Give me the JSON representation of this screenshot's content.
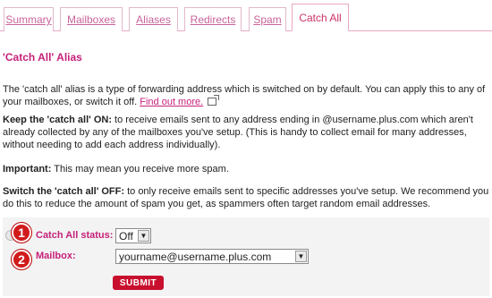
{
  "tabs": [
    {
      "label": "Summary"
    },
    {
      "label": "Mailboxes"
    },
    {
      "label": "Aliases"
    },
    {
      "label": "Redirects"
    },
    {
      "label": "Spam"
    },
    {
      "label": "Catch All",
      "active": true
    }
  ],
  "heading": "'Catch All' Alias",
  "intro": {
    "text": "The 'catch all' alias is a type of forwarding address which is switched on by default. You can apply this to any of your mailboxes, or switch it off.",
    "link": "Find out more."
  },
  "keep_on": {
    "bold": "Keep the 'catch all' ON:",
    "text": " to receive emails sent to any address ending in @username.plus.com which aren't already collected by any of the mailboxes you've setup. (This is handy to collect email for many addresses, without needing to add each address individually)."
  },
  "important": {
    "bold": "Important:",
    "text": " This may mean you receive more spam."
  },
  "switch_off": {
    "bold": "Switch the 'catch all' OFF:",
    "text": " to only receive emails sent to specific addresses you've setup. We recommend you do this to reduce the amount of spam you get, as spammers often target random email addresses."
  },
  "form": {
    "status_label": "Catch All status:",
    "status_value": "Off",
    "mailbox_label": "Mailbox:",
    "mailbox_value": "yourname@username.plus.com",
    "submit_label": "SUBMIT"
  },
  "badges": [
    "1",
    "2"
  ],
  "colors": {
    "accent": "#c6217a",
    "submit": "#c8102e",
    "badge": "#d11b1b"
  }
}
